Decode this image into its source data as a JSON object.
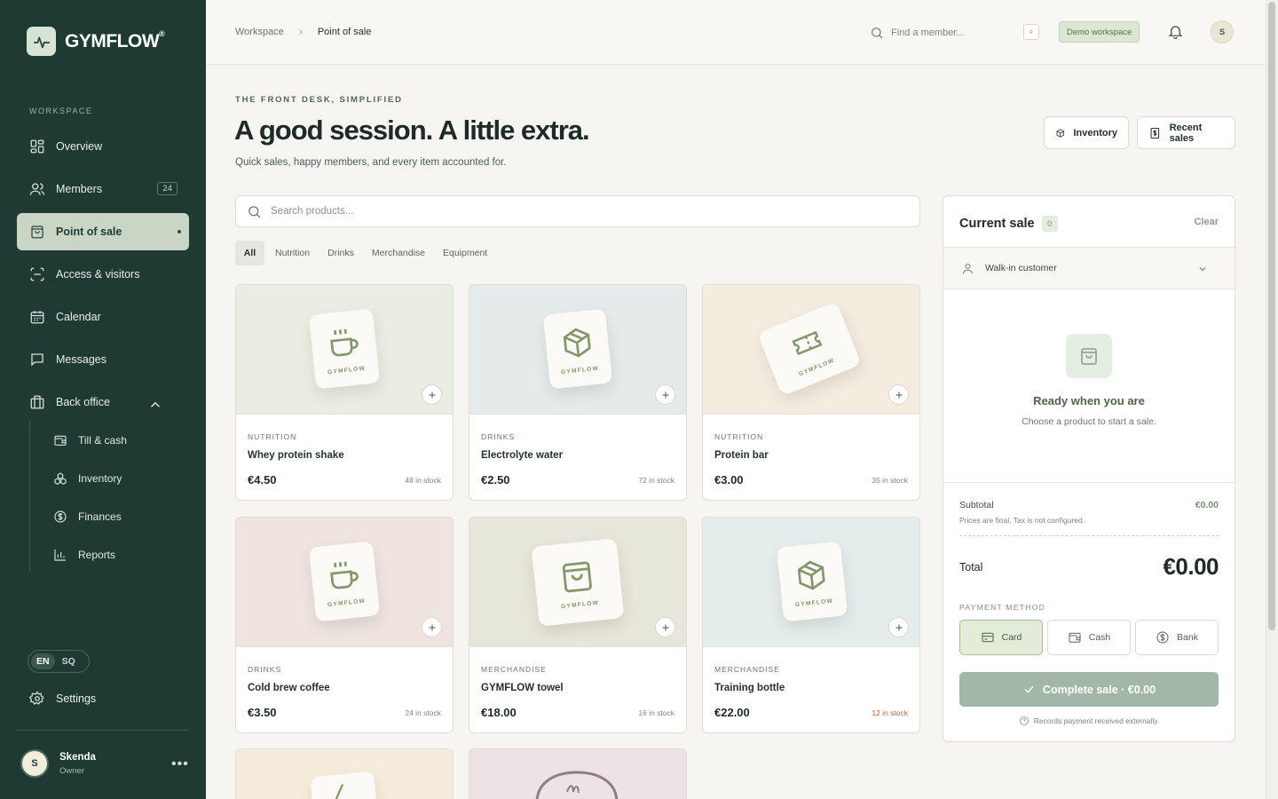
{
  "brand": {
    "name": "GYMFLOW",
    "reg": "®"
  },
  "sidebar": {
    "section_label": "WORKSPACE",
    "items": [
      {
        "label": "Overview",
        "icon": "grid-icon"
      },
      {
        "label": "Members",
        "icon": "users-icon",
        "badge": "24"
      },
      {
        "label": "Point of sale",
        "icon": "shopping-bag-icon",
        "active": true
      },
      {
        "label": "Access & visitors",
        "icon": "scan-icon"
      },
      {
        "label": "Calendar",
        "icon": "calendar-icon"
      },
      {
        "label": "Messages",
        "icon": "message-icon"
      },
      {
        "label": "Back office",
        "icon": "building-icon",
        "expanded": true
      }
    ],
    "subitems": [
      {
        "label": "Till & cash",
        "icon": "wallet-icon"
      },
      {
        "label": "Inventory",
        "icon": "boxes-icon"
      },
      {
        "label": "Finances",
        "icon": "dollar-circle-icon"
      },
      {
        "label": "Reports",
        "icon": "bar-chart-icon"
      }
    ],
    "lang": {
      "en": "EN",
      "sq": "SQ",
      "selected": "EN"
    },
    "settings_label": "Settings",
    "user": {
      "initial": "S",
      "name": "Skenda",
      "role": "Owner"
    }
  },
  "topbar": {
    "breadcrumb": [
      "Workspace",
      "Point of sale"
    ],
    "search_placeholder": "Find a member...",
    "kbd": "⌕",
    "workspace_badge": "Demo workspace",
    "avatar_initial": "S"
  },
  "page": {
    "eyebrow": "THE FRONT DESK, SIMPLIFIED",
    "title": "A good session. A little extra.",
    "subtitle": "Quick sales, happy members, and every item accounted for.",
    "btn_inventory": "Inventory",
    "btn_recent": "Recent sales",
    "product_search_placeholder": "Search products...",
    "tabs": [
      "All",
      "Nutrition",
      "Drinks",
      "Merchandise",
      "Equipment"
    ],
    "selected_tab": "All"
  },
  "products": [
    {
      "category": "NUTRITION",
      "name": "Whey protein shake",
      "price": "€4.50",
      "stock": "48 in stock",
      "icon": "coffee-cup-icon",
      "tile_text": "GYMFLOW",
      "bg": "#eaeee2"
    },
    {
      "category": "DRINKS",
      "name": "Electrolyte water",
      "price": "€2.50",
      "stock": "72 in stock",
      "icon": "box-icon",
      "tile_text": "GYMFLOW",
      "bg": "#e4ebea"
    },
    {
      "category": "NUTRITION",
      "name": "Protein bar",
      "price": "€3.00",
      "stock": "35 in stock",
      "icon": "ticket-icon",
      "tile_text": "GYMFLOW",
      "bg": "#f4ecdf"
    },
    {
      "category": "DRINKS",
      "name": "Cold brew coffee",
      "price": "€3.50",
      "stock": "24 in stock",
      "icon": "coffee-cup-icon",
      "tile_text": "GYMFLOW",
      "bg": "#efe4e0"
    },
    {
      "category": "MERCHANDISE",
      "name": "GYMFLOW towel",
      "price": "€18.00",
      "stock": "16 in stock",
      "icon": "shopping-bag-icon",
      "tile_text": "GYMFLOW",
      "bg": "#e7e6da"
    },
    {
      "category": "MERCHANDISE",
      "name": "Training bottle",
      "price": "€22.00",
      "stock": "12 in stock",
      "stock_low": true,
      "icon": "box-icon",
      "tile_text": "GYMFLOW",
      "bg": "#e5ecec"
    }
  ],
  "partial_cards": [
    {
      "bg": "#f6ecdc",
      "icon": "pulse-icon"
    },
    {
      "bg": "#ede2e6",
      "icon": "logo-mark-icon"
    }
  ],
  "sale": {
    "title": "Current sale",
    "count": "0",
    "clear": "Clear",
    "customer": "Walk-in customer",
    "empty_title": "Ready when you are",
    "empty_sub": "Choose a product to start a sale.",
    "subtotal_label": "Subtotal",
    "subtotal_value": "€0.00",
    "tax_note": "Prices are final. Tax is not configured.",
    "total_label": "Total",
    "total_value": "€0.00",
    "payment_label": "PAYMENT METHOD",
    "methods": [
      {
        "label": "Card",
        "icon": "credit-card-icon",
        "selected": true
      },
      {
        "label": "Cash",
        "icon": "wallet-icon"
      },
      {
        "label": "Bank",
        "icon": "dollar-circle-icon"
      }
    ],
    "complete": "Complete sale · €0.00",
    "external_note": "Records payment received externally."
  },
  "colors": {
    "sidebar": "#1f3a33",
    "accent": "#c9d6c6",
    "background": "#f6f5f1",
    "complete_button": "#a3b7a8"
  }
}
